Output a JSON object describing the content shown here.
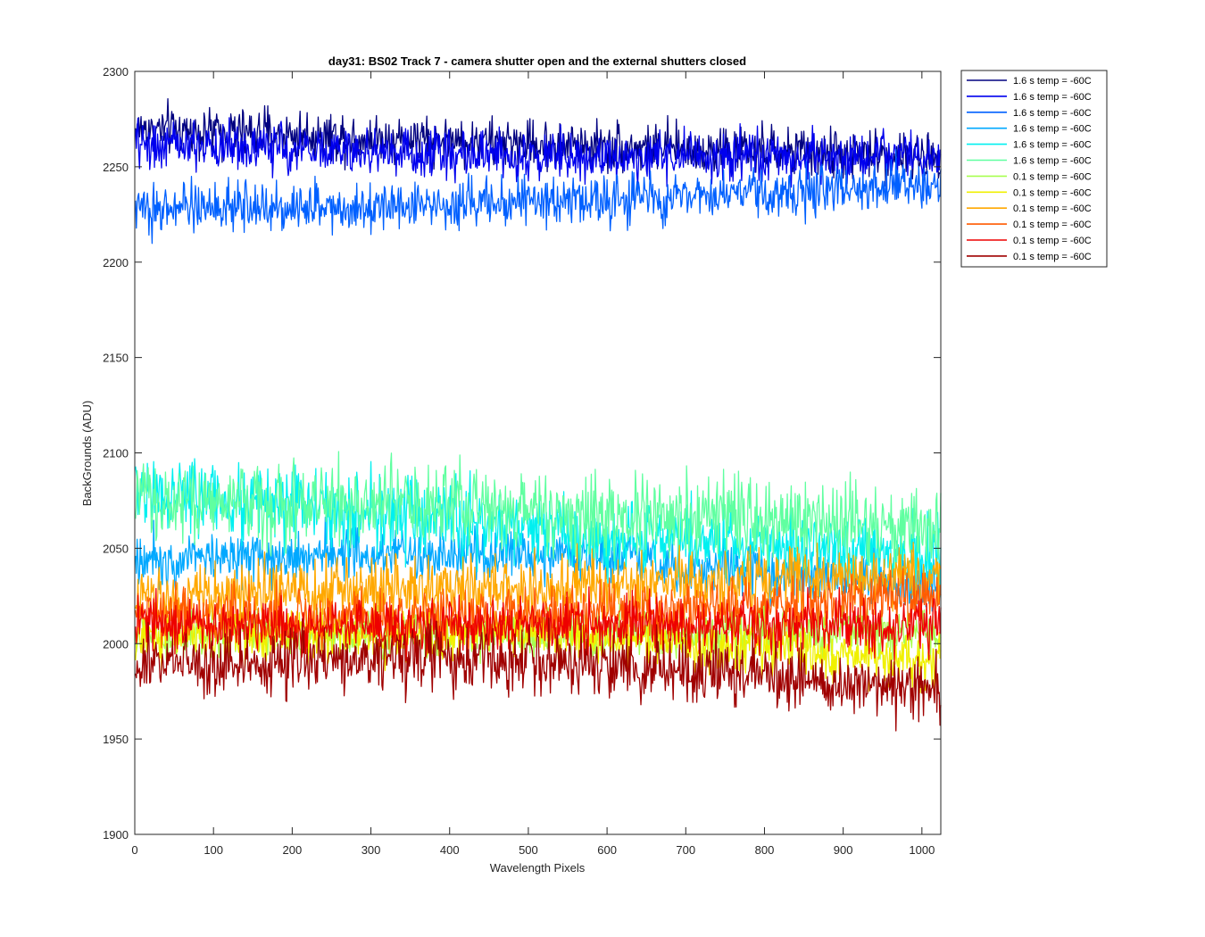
{
  "chart_data": {
    "type": "line",
    "title": "day31: BS02  Track 7 - camera shutter open and the external shutters closed",
    "xlabel": "Wavelength Pixels",
    "ylabel": "BackGrounds (ADU)",
    "xlim": [
      0,
      1024
    ],
    "ylim": [
      1900,
      2300
    ],
    "xticks": [
      "0",
      "100",
      "200",
      "300",
      "400",
      "500",
      "600",
      "700",
      "800",
      "900",
      "1000"
    ],
    "yticks": [
      "1900",
      "1950",
      "2000",
      "2050",
      "2100",
      "2150",
      "2200",
      "2250",
      "2300"
    ],
    "grid": false,
    "legend_position": "outside-top-right",
    "x_range": [
      1,
      1024
    ],
    "note_values": "Each series is a noisy trace over pixels 1-1024; listed values are the approximate mean level, start and end of each trace as read from the plot.",
    "series": [
      {
        "name": "1.6 s temp = -60C",
        "color": "#000080",
        "mean": 2262,
        "start": 2270,
        "end": 2255,
        "amplitude": 9
      },
      {
        "name": "1.6 s temp = -60C",
        "color": "#0000ee",
        "mean": 2256,
        "start": 2262,
        "end": 2255,
        "amplitude": 9
      },
      {
        "name": "1.6 s temp = -60C",
        "color": "#0060ff",
        "mean": 2232,
        "start": 2228,
        "end": 2240,
        "amplitude": 9
      },
      {
        "name": "1.6 s temp = -60C",
        "color": "#00a8ff",
        "mean": 2045,
        "start": 2045,
        "end": 2030,
        "amplitude": 10
      },
      {
        "name": "1.6 s temp = -60C",
        "color": "#00f0f0",
        "mean": 2060,
        "start": 2080,
        "end": 2045,
        "amplitude": 14
      },
      {
        "name": "1.6 s temp = -60C",
        "color": "#60ffa0",
        "mean": 2070,
        "start": 2075,
        "end": 2060,
        "amplitude": 15
      },
      {
        "name": "0.1 s temp = -60C",
        "color": "#a8ff50",
        "mean": 2005,
        "start": 2005,
        "end": 2005,
        "amplitude": 9
      },
      {
        "name": "0.1 s temp = -60C",
        "color": "#f0f000",
        "mean": 2003,
        "start": 2005,
        "end": 1990,
        "amplitude": 10
      },
      {
        "name": "0.1 s temp = -60C",
        "color": "#ffa800",
        "mean": 2030,
        "start": 2025,
        "end": 2035,
        "amplitude": 12
      },
      {
        "name": "0.1 s temp = -60C",
        "color": "#ff5a00",
        "mean": 2015,
        "start": 2015,
        "end": 2025,
        "amplitude": 10
      },
      {
        "name": "0.1 s temp = -60C",
        "color": "#ee0000",
        "mean": 2010,
        "start": 2010,
        "end": 2010,
        "amplitude": 10
      },
      {
        "name": "0.1 s temp = -60C",
        "color": "#a00000",
        "mean": 1990,
        "start": 1990,
        "end": 1975,
        "amplitude": 12
      }
    ]
  },
  "legend_entries": [
    "1.6 s temp = -60C",
    "1.6 s temp = -60C",
    "1.6 s temp = -60C",
    "1.6 s temp = -60C",
    "1.6 s temp = -60C",
    "1.6 s temp = -60C",
    "0.1 s temp = -60C",
    "0.1 s temp = -60C",
    "0.1 s temp = -60C",
    "0.1 s temp = -60C",
    "0.1 s temp = -60C",
    "0.1 s temp = -60C"
  ]
}
